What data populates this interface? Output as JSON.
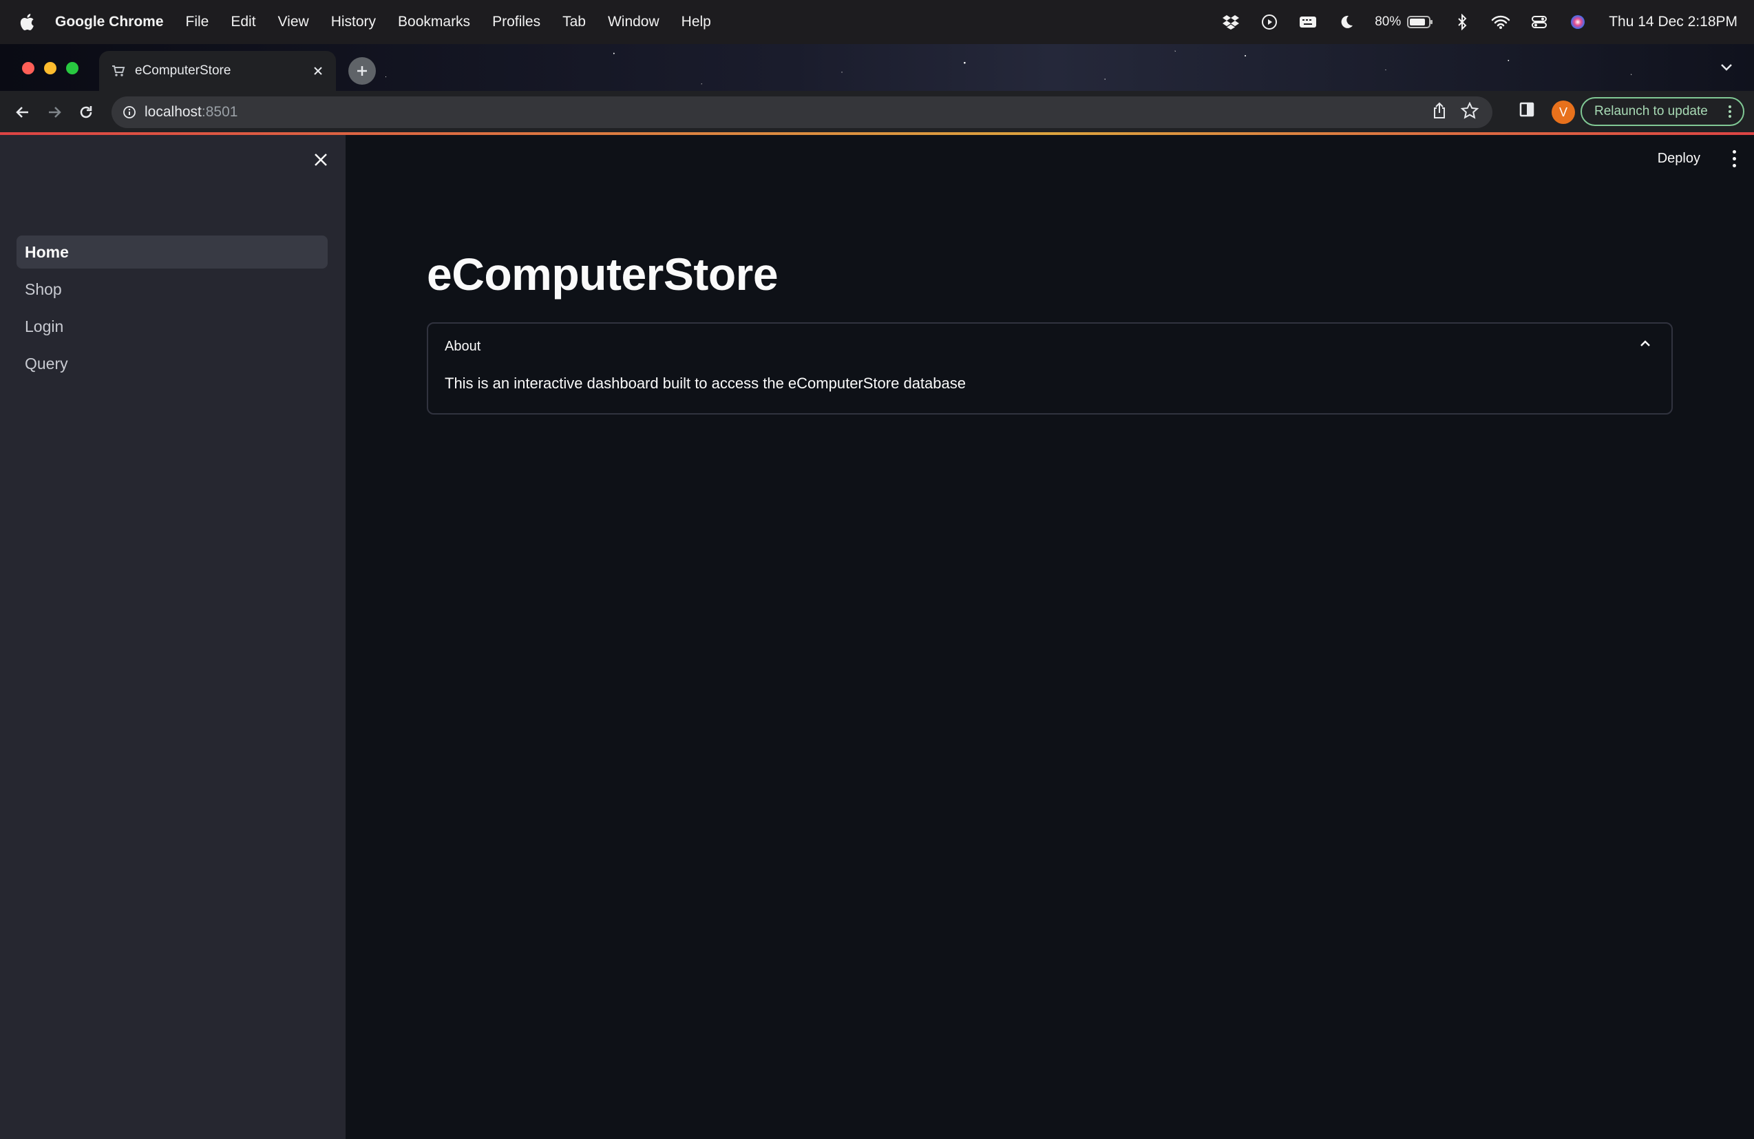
{
  "menubar": {
    "app_name": "Google Chrome",
    "items": [
      "File",
      "Edit",
      "View",
      "History",
      "Bookmarks",
      "Profiles",
      "Tab",
      "Window",
      "Help"
    ],
    "battery": "80%",
    "clock": "Thu 14 Dec  2:18PM"
  },
  "browser": {
    "tab_title": "eComputerStore",
    "url_host": "localhost",
    "url_port": ":8501",
    "profile_initial": "V",
    "relaunch_label": "Relaunch to update"
  },
  "app": {
    "deploy_label": "Deploy",
    "nav": [
      {
        "label": "Home",
        "active": true
      },
      {
        "label": "Shop",
        "active": false
      },
      {
        "label": "Login",
        "active": false
      },
      {
        "label": "Query",
        "active": false
      }
    ],
    "title": "eComputerStore",
    "expander": {
      "header": "About",
      "body": "This is an interactive dashboard built to access the eComputerStore database"
    }
  }
}
